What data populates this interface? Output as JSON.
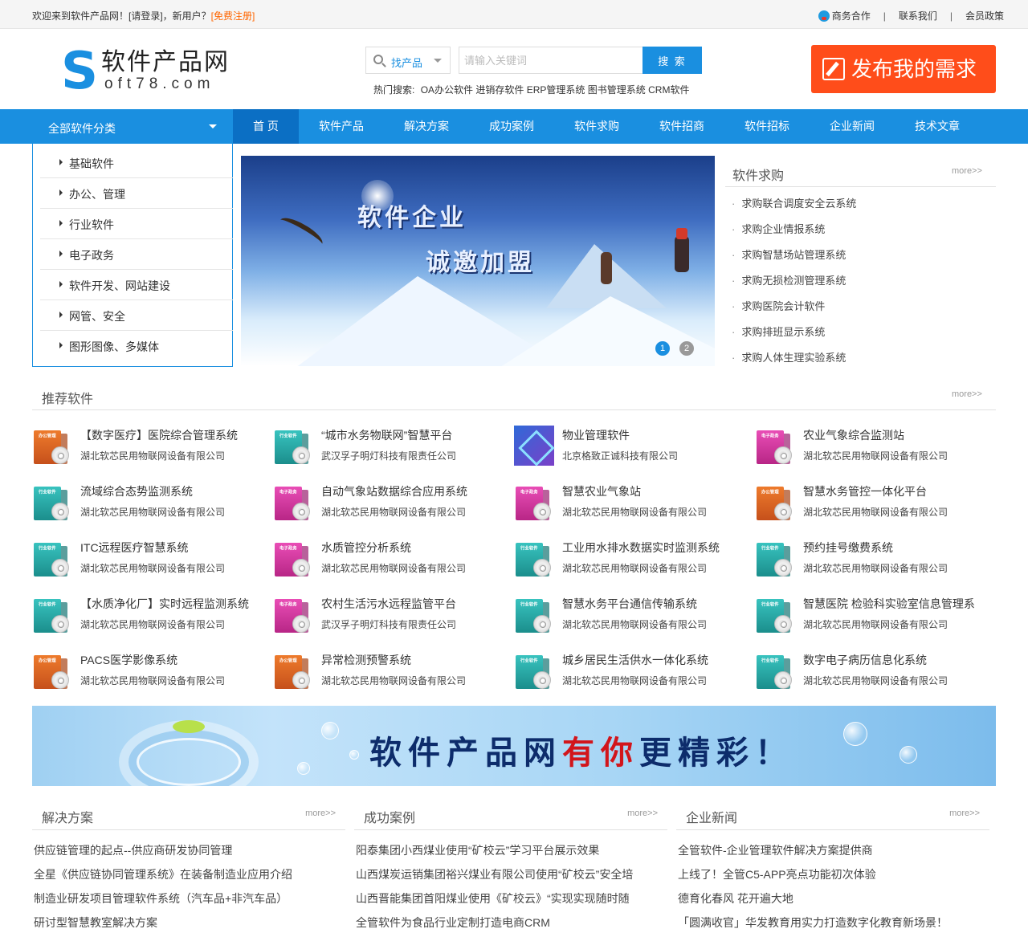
{
  "topbar": {
    "welcome": "欢迎来到软件产品网！[请登录]，新用户？",
    "register": "[免费注册]",
    "links": [
      "商务合作",
      "联系我们",
      "会员政策"
    ],
    "separator": "|"
  },
  "logo": {
    "mark": "S",
    "cn": "软件产品网",
    "en": "oft78.com"
  },
  "search": {
    "type_label": "找产品",
    "placeholder": "请输入关键词",
    "button": "搜 索",
    "hot_label": "热门搜索:",
    "hot": [
      "OA办公软件",
      "进销存软件",
      "ERP管理系统",
      "图书管理系统",
      "CRM软件"
    ]
  },
  "publish": {
    "label": "发布我的需求"
  },
  "nav": {
    "all_categories": "全部软件分类",
    "items": [
      "首 页",
      "软件产品",
      "解决方案",
      "成功案例",
      "软件求购",
      "软件招商",
      "软件招标",
      "企业新闻",
      "技术文章"
    ]
  },
  "categories": [
    "基础软件",
    "办公、管理",
    "行业软件",
    "电子政务",
    "软件开发、网站建设",
    "网管、安全",
    "图形图像、多媒体"
  ],
  "banner": {
    "line1": "软件企业",
    "line2": "诚邀加盟",
    "dots": [
      "1",
      "2"
    ]
  },
  "demand": {
    "title": "软件求购",
    "more": "more>>",
    "items": [
      "求购联合调度安全云系统",
      "求购企业情报系统",
      "求购智慧场站管理系统",
      "求购无损检测管理系统",
      "求购医院会计软件",
      "求购排班显示系统",
      "求购人体生理实验系统"
    ]
  },
  "recommend": {
    "title": "推荐软件",
    "more": "more>>",
    "items": [
      {
        "name": "【数字医疗】医院综合管理系统",
        "company": "湖北软芯民用物联网设备有限公司",
        "tag": "办公管理",
        "color": "orange"
      },
      {
        "name": "“城市水务物联网”智慧平台",
        "company": "武汉孚子明灯科技有限责任公司",
        "tag": "行业软件",
        "color": "teal"
      },
      {
        "name": "物业管理软件",
        "company": "北京格致正诚科技有限公司",
        "tag": "",
        "color": "photo"
      },
      {
        "name": "农业气象综合监测站",
        "company": "湖北软芯民用物联网设备有限公司",
        "tag": "电子政务",
        "color": "pink"
      },
      {
        "name": "流域综合态势监测系统",
        "company": "湖北软芯民用物联网设备有限公司",
        "tag": "行业软件",
        "color": "teal"
      },
      {
        "name": "自动气象站数据综合应用系统",
        "company": "湖北软芯民用物联网设备有限公司",
        "tag": "电子政务",
        "color": "pink"
      },
      {
        "name": "智慧农业气象站",
        "company": "湖北软芯民用物联网设备有限公司",
        "tag": "电子政务",
        "color": "pink"
      },
      {
        "name": "智慧水务管控一体化平台",
        "company": "湖北软芯民用物联网设备有限公司",
        "tag": "办公管理",
        "color": "orange"
      },
      {
        "name": "ITC远程医疗智慧系统",
        "company": "湖北软芯民用物联网设备有限公司",
        "tag": "行业软件",
        "color": "teal"
      },
      {
        "name": "水质管控分析系统",
        "company": "湖北软芯民用物联网设备有限公司",
        "tag": "电子政务",
        "color": "pink"
      },
      {
        "name": "工业用水排水数据实时监测系统",
        "company": "湖北软芯民用物联网设备有限公司",
        "tag": "行业软件",
        "color": "teal"
      },
      {
        "name": "预约挂号缴费系统",
        "company": "湖北软芯民用物联网设备有限公司",
        "tag": "行业软件",
        "color": "teal"
      },
      {
        "name": "【水质净化厂】实时远程监测系统",
        "company": "湖北软芯民用物联网设备有限公司",
        "tag": "行业软件",
        "color": "teal"
      },
      {
        "name": "农村生活污水远程监管平台",
        "company": "武汉孚子明灯科技有限责任公司",
        "tag": "电子政务",
        "color": "pink"
      },
      {
        "name": "智慧水务平台通信传输系统",
        "company": "湖北软芯民用物联网设备有限公司",
        "tag": "行业软件",
        "color": "teal"
      },
      {
        "name": "智慧医院 检验科实验室信息管理系",
        "company": "湖北软芯民用物联网设备有限公司",
        "tag": "行业软件",
        "color": "teal"
      },
      {
        "name": "PACS医学影像系统",
        "company": "湖北软芯民用物联网设备有限公司",
        "tag": "办公管理",
        "color": "orange"
      },
      {
        "name": "异常检测预警系统",
        "company": "湖北软芯民用物联网设备有限公司",
        "tag": "办公管理",
        "color": "orange"
      },
      {
        "name": "城乡居民生活供水一体化系统",
        "company": "湖北软芯民用物联网设备有限公司",
        "tag": "行业软件",
        "color": "teal"
      },
      {
        "name": "数字电子病历信息化系统",
        "company": "湖北软芯民用物联网设备有限公司",
        "tag": "行业软件",
        "color": "teal"
      }
    ]
  },
  "ad": {
    "part1": "软件产品网",
    "part2": "有你",
    "part3": "更精彩！"
  },
  "columns": [
    {
      "title": "解决方案",
      "more": "more>>",
      "items": [
        "供应链管理的起点--供应商研发协同管理",
        "全星《供应链协同管理系统》在装备制造业应用介绍",
        "制造业研发项目管理软件系统（汽车品+非汽车品）",
        "研讨型智慧教室解决方案"
      ]
    },
    {
      "title": "成功案例",
      "more": "more>>",
      "items": [
        "阳泰集团小西煤业使用“矿校云”学习平台展示效果",
        "山西煤炭运销集团裕兴煤业有限公司使用“矿校云”安全培",
        "山西晋能集团首阳煤业使用《矿校云》“实现实现随时随",
        "全管软件为食品行业定制打造电商CRM"
      ]
    },
    {
      "title": "企业新闻",
      "more": "more>>",
      "items": [
        "全管软件-企业管理软件解决方案提供商",
        "上线了！全管C5-APP亮点功能初次体验",
        "德育化春风 花开遍大地",
        "「圆满收官」华发教育用实力打造数字化教育新场景！"
      ]
    }
  ]
}
